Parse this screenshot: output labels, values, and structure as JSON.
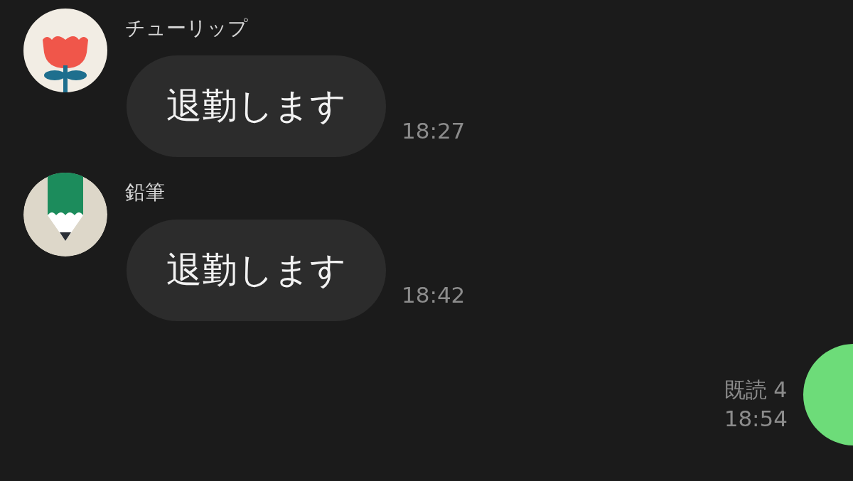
{
  "messages": [
    {
      "kind": "incoming",
      "avatar": {
        "kind": "tulip"
      },
      "sender": "チューリップ",
      "text": "退勤します",
      "time": "18:27"
    },
    {
      "kind": "incoming",
      "avatar": {
        "kind": "pencil"
      },
      "sender": "鉛筆",
      "text": "退勤します",
      "time": "18:42"
    },
    {
      "kind": "outgoing",
      "read": "既読 4",
      "time": "18:54"
    }
  ]
}
